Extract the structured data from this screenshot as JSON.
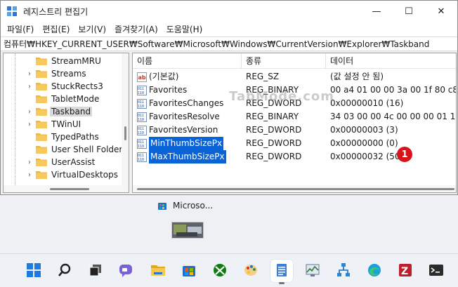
{
  "window": {
    "title": "레지스트리 편집기",
    "controls": {
      "minimize": "—",
      "maximize": "☐",
      "close": "✕"
    }
  },
  "menu": [
    "파일(F)",
    "편집(E)",
    "보기(V)",
    "즐겨찾기(A)",
    "도움말(H)"
  ],
  "address": "컴퓨터₩HKEY_CURRENT_USER₩Software₩Microsoft₩Windows₩CurrentVersion₩Explorer₩Taskband",
  "tree": {
    "items": [
      {
        "label": "StreamMRU",
        "expandable": false,
        "selected": false
      },
      {
        "label": "Streams",
        "expandable": true,
        "selected": false
      },
      {
        "label": "StuckRects3",
        "expandable": true,
        "selected": false
      },
      {
        "label": "TabletMode",
        "expandable": false,
        "selected": false
      },
      {
        "label": "Taskband",
        "expandable": true,
        "selected": true
      },
      {
        "label": "TWinUI",
        "expandable": true,
        "selected": false
      },
      {
        "label": "TypedPaths",
        "expandable": false,
        "selected": false
      },
      {
        "label": "User Shell Folders",
        "expandable": false,
        "selected": false
      },
      {
        "label": "UserAssist",
        "expandable": true,
        "selected": false
      },
      {
        "label": "VirtualDesktops",
        "expandable": true,
        "selected": false
      }
    ]
  },
  "list": {
    "headers": {
      "name": "이름",
      "type": "종류",
      "data": "데이터"
    },
    "rows": [
      {
        "name": "(기본값)",
        "type": "REG_SZ",
        "data": "(값 설정 안 됨)",
        "icon": "string-value-icon",
        "selected": false
      },
      {
        "name": "Favorites",
        "type": "REG_BINARY",
        "data": "00 a4 01 00 00 3a 00 1f 80 c8 27",
        "icon": "binary-value-icon",
        "selected": false
      },
      {
        "name": "FavoritesChanges",
        "type": "REG_DWORD",
        "data": "0x00000010 (16)",
        "icon": "binary-value-icon",
        "selected": false
      },
      {
        "name": "FavoritesResolve",
        "type": "REG_BINARY",
        "data": "34 03 00 00 4c 00 00 00 01 14 0",
        "icon": "binary-value-icon",
        "selected": false
      },
      {
        "name": "FavoritesVersion",
        "type": "REG_DWORD",
        "data": "0x00000003 (3)",
        "icon": "binary-value-icon",
        "selected": false
      },
      {
        "name": "MinThumbSizePx",
        "type": "REG_DWORD",
        "data": "0x00000000 (0)",
        "icon": "binary-value-icon",
        "selected": true
      },
      {
        "name": "MaxThumbSizePx",
        "type": "REG_DWORD",
        "data": "0x00000032 (50)",
        "icon": "binary-value-icon",
        "selected": true
      }
    ]
  },
  "annotation": {
    "badge": "1",
    "watermark": "TabMode.com"
  },
  "preview": {
    "label": "Microso..."
  },
  "taskbar": {
    "icons": [
      "start-icon",
      "search-icon",
      "task-view-icon",
      "chat-icon",
      "file-explorer-icon",
      "store-icon",
      "xbox-icon",
      "paint-icon",
      "notepad-icon",
      "resource-monitor-icon",
      "network-icon",
      "edge-icon",
      "filezilla-icon",
      "terminal-icon"
    ],
    "active": "notepad-icon"
  },
  "colors": {
    "selection": "#0a64d8",
    "badge": "#d7141a",
    "folder": "#e8b84a"
  }
}
